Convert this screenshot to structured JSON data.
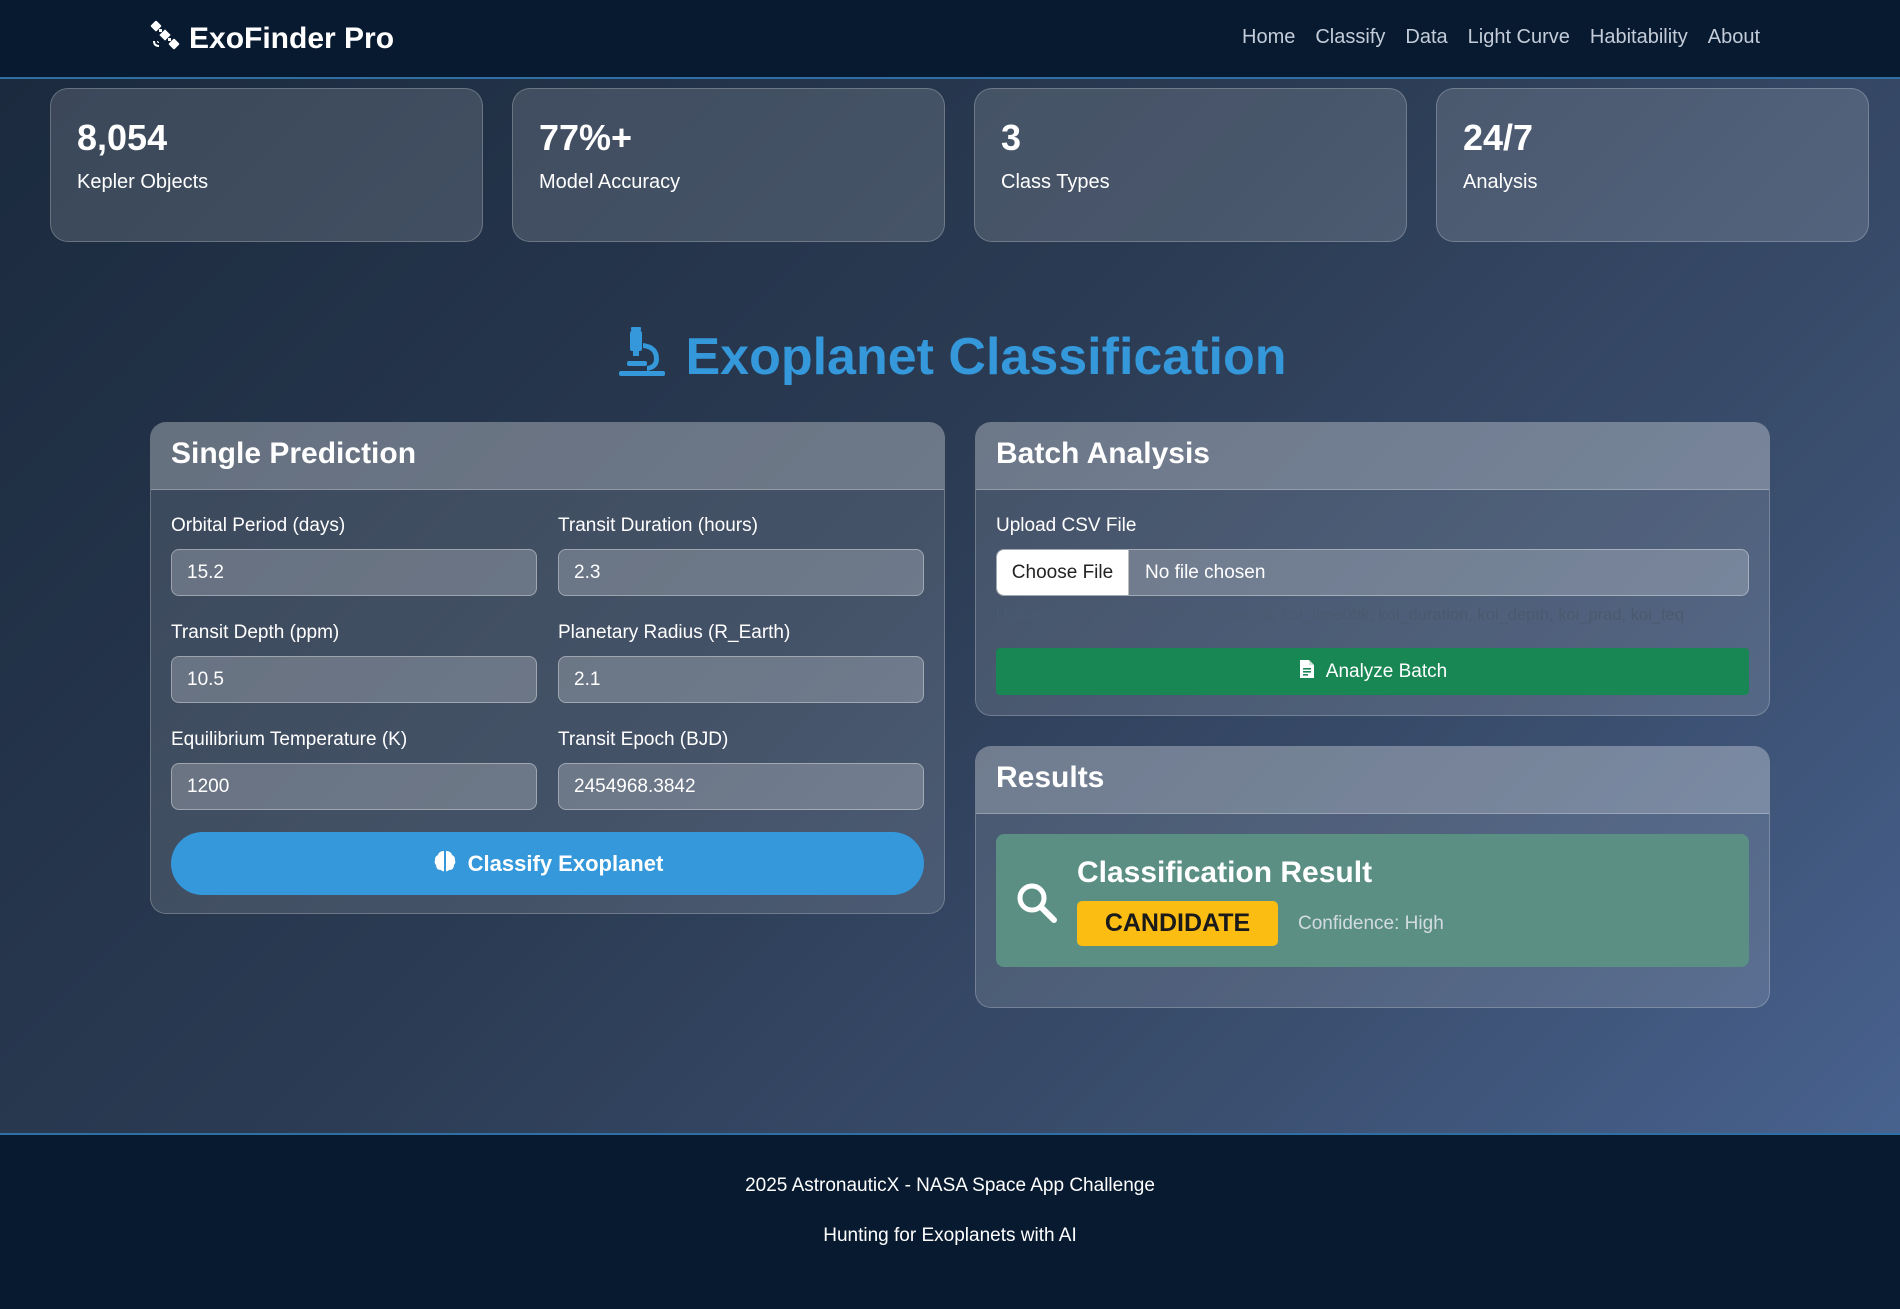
{
  "navbar": {
    "brand": "ExoFinder Pro",
    "brand_icon": "satellite-icon",
    "links": [
      {
        "label": "Home"
      },
      {
        "label": "Classify"
      },
      {
        "label": "Data"
      },
      {
        "label": "Light Curve"
      },
      {
        "label": "Habitability"
      },
      {
        "label": "About"
      }
    ]
  },
  "stats": [
    {
      "value": "8,054",
      "label": "Kepler Objects"
    },
    {
      "value": "77%+",
      "label": "Model Accuracy"
    },
    {
      "value": "3",
      "label": "Class Types"
    },
    {
      "value": "24/7",
      "label": "Analysis"
    }
  ],
  "section": {
    "title": "Exoplanet Classification",
    "icon": "microscope-icon"
  },
  "single": {
    "title": "Single Prediction",
    "fields": [
      {
        "label": "Orbital Period (days)",
        "value": "15.2"
      },
      {
        "label": "Transit Duration (hours)",
        "value": "2.3"
      },
      {
        "label": "Transit Depth (ppm)",
        "value": "10.5"
      },
      {
        "label": "Planetary Radius (R_Earth)",
        "value": "2.1"
      },
      {
        "label": "Equilibrium Temperature (K)",
        "value": "1200"
      },
      {
        "label": "Transit Epoch (BJD)",
        "value": "2454968.3842"
      }
    ],
    "button_label": "Classify Exoplanet",
    "button_icon": "brain-icon"
  },
  "batch": {
    "title": "Batch Analysis",
    "upload_label": "Upload CSV File",
    "choose_label": "Choose File",
    "file_status": "No file chosen",
    "help_text": "Upload CSV with columns: koi_period, koi_time0bk, koi_duration, koi_depth, koi_prad, koi_teq",
    "button_label": "Analyze Batch",
    "button_icon": "file-csv-icon"
  },
  "results": {
    "title": "Results",
    "result_title": "Classification Result",
    "badge": "CANDIDATE",
    "confidence": "Confidence: High",
    "icon": "search-icon"
  },
  "footer": {
    "line1": "2025 AstronauticX - NASA Space App Challenge",
    "line2": "Hunting for Exoplanets with AI"
  },
  "colors": {
    "accent": "#3498db",
    "success": "#198754",
    "warning": "#fcbd13",
    "navbar": "#081a30"
  }
}
